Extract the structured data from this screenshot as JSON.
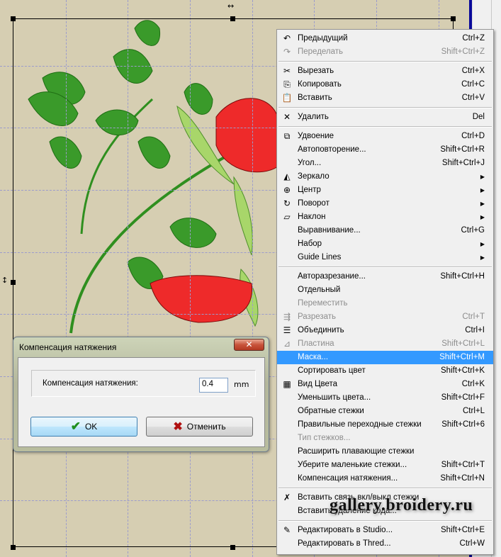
{
  "menu": {
    "items": [
      {
        "label": "Предыдущий",
        "shortcut": "Ctrl+Z",
        "icon": "undo-icon"
      },
      {
        "label": "Переделать",
        "shortcut": "Shift+Ctrl+Z",
        "icon": "redo-icon",
        "disabled": true
      },
      {
        "label": "Вырезать",
        "shortcut": "Ctrl+X",
        "icon": "scissors-icon"
      },
      {
        "label": "Копировать",
        "shortcut": "Ctrl+C",
        "icon": "copy-icon"
      },
      {
        "label": "Вставить",
        "shortcut": "Ctrl+V",
        "icon": "paste-icon"
      },
      {
        "label": "Удалить",
        "shortcut": "Del",
        "icon": "delete-x-icon"
      },
      {
        "label": "Удвоение",
        "shortcut": "Ctrl+D",
        "icon": "duplicate-icon"
      },
      {
        "label": "Автоповторение...",
        "shortcut": "Shift+Ctrl+R"
      },
      {
        "label": "Угол...",
        "shortcut": "Shift+Ctrl+J"
      },
      {
        "label": "Зеркало",
        "submenu": true,
        "icon": "mirror-icon"
      },
      {
        "label": "Центр",
        "submenu": true,
        "icon": "center-icon"
      },
      {
        "label": "Поворот",
        "submenu": true,
        "icon": "rotate-icon"
      },
      {
        "label": "Наклон",
        "submenu": true,
        "icon": "skew-icon"
      },
      {
        "label": "Выравнивание...",
        "shortcut": "Ctrl+G"
      },
      {
        "label": "Набор",
        "submenu": true
      },
      {
        "label": "Guide Lines",
        "submenu": true
      },
      {
        "label": "Авторазрезание...",
        "shortcut": "Shift+Ctrl+H"
      },
      {
        "label": "Отдельный",
        "shortcut": ""
      },
      {
        "label": "Переместить",
        "shortcut": "",
        "disabled": true
      },
      {
        "label": "Разрезать",
        "shortcut": "Ctrl+T",
        "icon": "split-icon",
        "disabled": true
      },
      {
        "label": "Объединить",
        "shortcut": "Ctrl+I",
        "icon": "merge-icon"
      },
      {
        "label": "Пластина",
        "shortcut": "Shift+Ctrl+L",
        "icon": "plate-icon",
        "disabled": true
      },
      {
        "label": "Маска...",
        "shortcut": "Shift+Ctrl+M",
        "highlighted": true
      },
      {
        "label": "Сортировать цвет",
        "shortcut": "Shift+Ctrl+K"
      },
      {
        "label": "Вид Цвета",
        "shortcut": "Ctrl+K",
        "icon": "color-grid-icon"
      },
      {
        "label": "Уменьшить цвета...",
        "shortcut": "Shift+Ctrl+F"
      },
      {
        "label": "Обратные стежки",
        "shortcut": "Ctrl+L"
      },
      {
        "label": "Правильные переходные стежки",
        "shortcut": "Shift+Ctrl+6"
      },
      {
        "label": "Тип стежков...",
        "shortcut": "",
        "disabled": true
      },
      {
        "label": "Расширить плавающие стежки",
        "shortcut": ""
      },
      {
        "label": "Уберите маленькие стежки...",
        "shortcut": "Shift+Ctrl+T"
      },
      {
        "label": "Компенсация натяжения...",
        "shortcut": "Shift+Ctrl+N"
      },
      {
        "label": "Вставить связь вкл/выкл стежки",
        "shortcut": "",
        "icon": "stitch-link-icon"
      },
      {
        "label": "Вставить удаление кода...",
        "shortcut": ""
      },
      {
        "label": "Редактировать в Studio...",
        "shortcut": "Shift+Ctrl+E",
        "icon": "edit-studio-icon"
      },
      {
        "label": "Редактировать в Thred...",
        "shortcut": "Ctrl+W"
      }
    ]
  },
  "watermark": "gallery.broidery.ru",
  "dialog": {
    "title": "Компенсация натяжения",
    "field_label": "Компенсация натяжения:",
    "value": "0.4",
    "unit": "mm",
    "ok": "OK",
    "cancel": "Отменить",
    "close": "✕"
  },
  "colors": {
    "highlight": "#3399ff",
    "canvas": "#d6ceb2",
    "leaf": "#2f8f1f",
    "rose": "#e62020"
  }
}
